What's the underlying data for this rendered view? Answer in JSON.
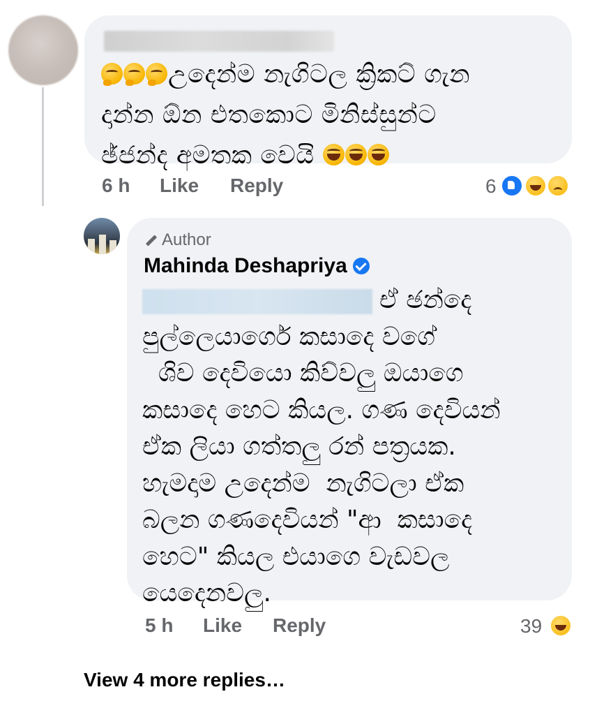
{
  "comment1": {
    "author_name": "",
    "text_line1": "උදෙන්ම නැගිටල ක්‍රිකට් ගැන",
    "text_line2": "දාන්න ඕන එතකොට මිනිස්සුන්ට",
    "text_line3": "ඡ්ජන්ද අමතක වෙයි",
    "leading_emojis": [
      "thinking-face",
      "thinking-face",
      "thinking-face"
    ],
    "trailing_emojis": [
      "rolling-laughing",
      "rolling-laughing",
      "rolling-laughing"
    ],
    "time": "6 h",
    "like_label": "Like",
    "reply_label": "Reply",
    "reaction_count": "6",
    "reactions": [
      "like",
      "haha",
      "sad"
    ]
  },
  "reply1": {
    "author_badge": "Author",
    "author_name": "Mahinda Deshapriya",
    "verified": true,
    "lines": [
      "ඒ ඡන්දෙ",
      "පුල්ලෙයාර්ගෙ කසාදෙ වගේ",
      "  ශිව දෙවියො කිව්වලු ඔයාගෙ",
      "කසාදෙ හෙට කියල. ගණ දෙවියන්",
      "ඒක ලියා ගත්තලු රන් පත්‍රයක.",
      "හැමදාම උදෙන්ම  නැගිටලා ඒක",
      "බලන ගණදෙවියන් \"ආ  කසාදෙ",
      "හෙට\" කියල එයාගෙ වැඩවල",
      "යෙදෙනවලු."
    ],
    "time": "5 h",
    "like_label": "Like",
    "reply_label": "Reply",
    "reaction_count": "39",
    "reactions": [
      "haha"
    ]
  },
  "view_more_label": "View 4 more replies…",
  "colors": {
    "bubble": "#f0f2f5",
    "meta_text": "#65676b",
    "like_blue": "#1877f2"
  }
}
